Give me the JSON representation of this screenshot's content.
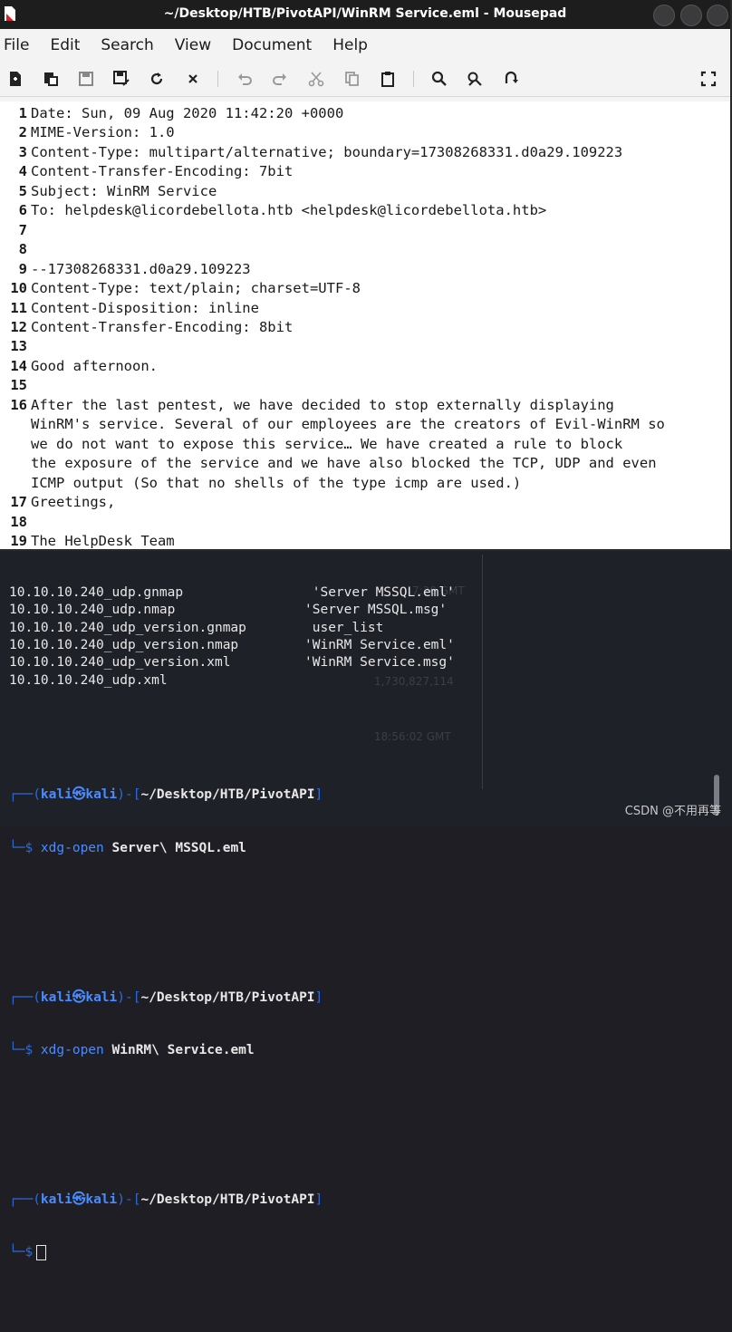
{
  "window": {
    "title": "~/Desktop/HTB/PivotAPI/WinRM Service.eml - Mousepad"
  },
  "menu": [
    "File",
    "Edit",
    "Search",
    "View",
    "Document",
    "Help"
  ],
  "editor": {
    "lines": [
      {
        "n": "1",
        "text": "Date: Sun, 09 Aug 2020 11:42:20 +0000"
      },
      {
        "n": "2",
        "text": "MIME-Version: 1.0"
      },
      {
        "n": "3",
        "text": "Content-Type: multipart/alternative; boundary=17308268331.d0a29.109223"
      },
      {
        "n": "4",
        "text": "Content-Transfer-Encoding: 7bit"
      },
      {
        "n": "5",
        "text": "Subject: WinRM Service"
      },
      {
        "n": "6",
        "text": "To: helpdesk@licordebellota.htb <helpdesk@licordebellota.htb>"
      },
      {
        "n": "7",
        "text": ""
      },
      {
        "n": "8",
        "text": ""
      },
      {
        "n": "9",
        "text": "--17308268331.d0a29.109223"
      },
      {
        "n": "10",
        "text": "Content-Type: text/plain; charset=UTF-8"
      },
      {
        "n": "11",
        "text": "Content-Disposition: inline"
      },
      {
        "n": "12",
        "text": "Content-Transfer-Encoding: 8bit"
      },
      {
        "n": "13",
        "text": ""
      },
      {
        "n": "14",
        "text": "Good afternoon."
      },
      {
        "n": "15",
        "text": ""
      },
      {
        "n": "16",
        "text": "After the last pentest, we have decided to stop externally displaying"
      },
      {
        "n": "",
        "text": "WinRM's service. Several of our employees are the creators of Evil-WinRM so"
      },
      {
        "n": "",
        "text": "we do not want to expose this service… We have created a rule to block"
      },
      {
        "n": "",
        "text": "the exposure of the service and we have also blocked the TCP, UDP and even"
      },
      {
        "n": "",
        "text": "ICMP output (So that no shells of the type icmp are used.)"
      },
      {
        "n": "17",
        "text": "Greetings,"
      },
      {
        "n": "18",
        "text": ""
      },
      {
        "n": "19",
        "text": "The HelpDesk Team"
      }
    ]
  },
  "terminal": {
    "ls_rows": [
      [
        "10.10.10.240_udp.gnmap",
        " 'Server MSSQL.eml'"
      ],
      [
        "10.10.10.240_udp.nmap",
        "'Server MSSQL.msg'"
      ],
      [
        "10.10.10.240_udp_version.gnmap",
        " user_list"
      ],
      [
        "10.10.10.240_udp_version.nmap",
        "'WinRM Service.eml'"
      ],
      [
        "10.10.10.240_udp_version.xml",
        "'WinRM Service.msg'"
      ],
      [
        "10.10.10.240_udp.xml",
        ""
      ]
    ],
    "user": "kali",
    "host": "kali",
    "cwd": "~/Desktop/HTB/PivotAPI",
    "commands": [
      {
        "cmd": "xdg-open",
        "arg": "Server\\ MSSQL.eml"
      },
      {
        "cmd": "xdg-open",
        "arg": "WinRM\\ Service.eml"
      }
    ],
    "background_text": [
      "7:20 GMT",
      "1,730,827,114",
      "18:56:02 GMT"
    ]
  },
  "watermark": "CSDN @不用再等"
}
